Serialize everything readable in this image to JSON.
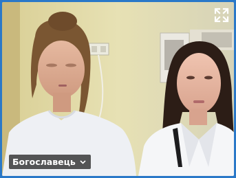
{
  "participant": {
    "name": "Богославець"
  },
  "icons": {
    "expand": "fullscreen-expand-icon",
    "dropdown": "chevron-down-icon"
  },
  "colors": {
    "frame_border": "#2a78c8",
    "name_tag_bg": "#282828",
    "name_tag_text": "#ffffff"
  }
}
